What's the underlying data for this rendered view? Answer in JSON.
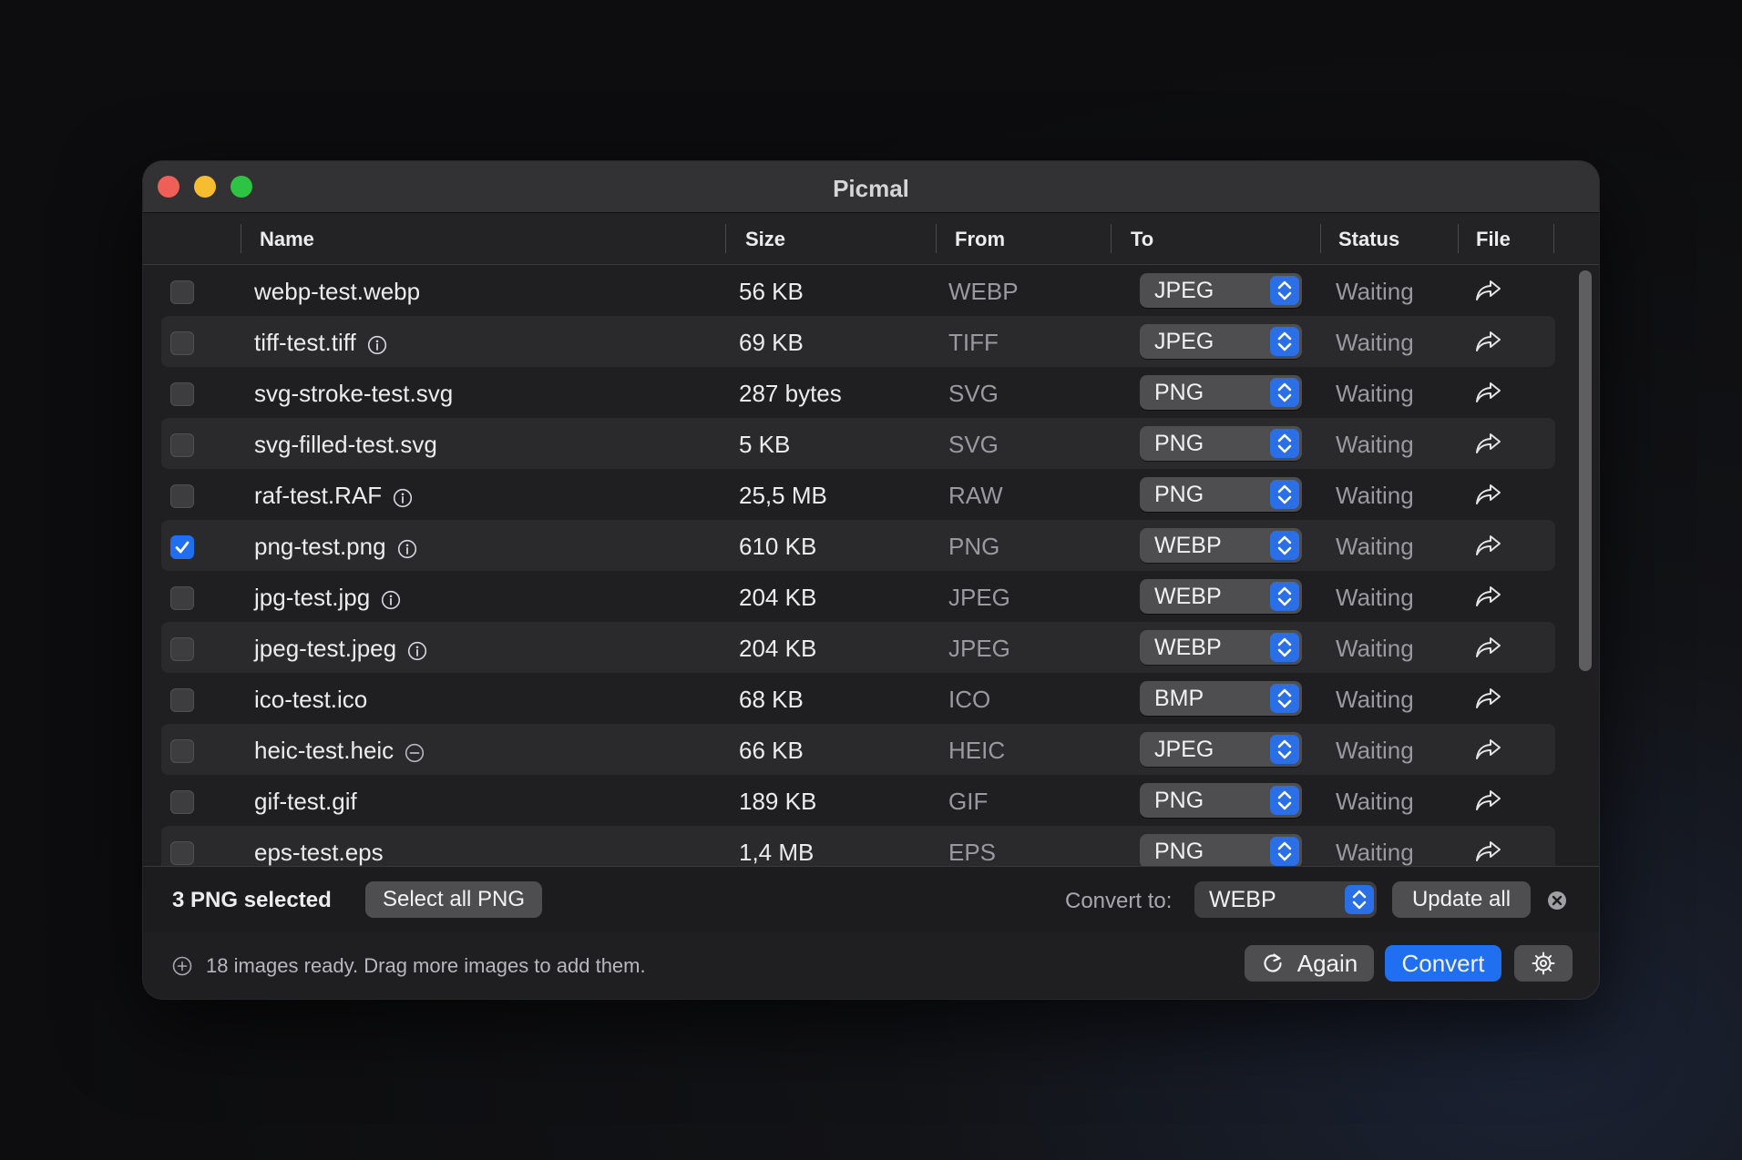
{
  "window": {
    "title": "Picmal"
  },
  "columns": {
    "name": "Name",
    "size": "Size",
    "from": "From",
    "to": "To",
    "status": "Status",
    "file": "File"
  },
  "rows": [
    {
      "name": "webp-test.webp",
      "info": "",
      "size": "56 KB",
      "from": "WEBP",
      "to": "JPEG",
      "status": "Waiting",
      "checked": false
    },
    {
      "name": "tiff-test.tiff",
      "info": "info",
      "size": "69 KB",
      "from": "TIFF",
      "to": "JPEG",
      "status": "Waiting",
      "checked": false
    },
    {
      "name": "svg-stroke-test.svg",
      "info": "",
      "size": "287 bytes",
      "from": "SVG",
      "to": "PNG",
      "status": "Waiting",
      "checked": false
    },
    {
      "name": "svg-filled-test.svg",
      "info": "",
      "size": "5 KB",
      "from": "SVG",
      "to": "PNG",
      "status": "Waiting",
      "checked": false
    },
    {
      "name": "raf-test.RAF",
      "info": "info",
      "size": "25,5 MB",
      "from": "RAW",
      "to": "PNG",
      "status": "Waiting",
      "checked": false
    },
    {
      "name": "png-test.png",
      "info": "info",
      "size": "610 KB",
      "from": "PNG",
      "to": "WEBP",
      "status": "Waiting",
      "checked": true
    },
    {
      "name": "jpg-test.jpg",
      "info": "info",
      "size": "204 KB",
      "from": "JPEG",
      "to": "WEBP",
      "status": "Waiting",
      "checked": false
    },
    {
      "name": "jpeg-test.jpeg",
      "info": "info",
      "size": "204 KB",
      "from": "JPEG",
      "to": "WEBP",
      "status": "Waiting",
      "checked": false
    },
    {
      "name": "ico-test.ico",
      "info": "",
      "size": "68 KB",
      "from": "ICO",
      "to": "BMP",
      "status": "Waiting",
      "checked": false
    },
    {
      "name": "heic-test.heic",
      "info": "minus",
      "size": "66 KB",
      "from": "HEIC",
      "to": "JPEG",
      "status": "Waiting",
      "checked": false
    },
    {
      "name": "gif-test.gif",
      "info": "",
      "size": "189 KB",
      "from": "GIF",
      "to": "PNG",
      "status": "Waiting",
      "checked": false
    },
    {
      "name": "eps-test.eps",
      "info": "",
      "size": "1,4 MB",
      "from": "EPS",
      "to": "PNG",
      "status": "Waiting",
      "checked": false
    }
  ],
  "toolbar": {
    "selection": "3 PNG selected",
    "select_all_label": "Select all PNG",
    "convert_to_label": "Convert to:",
    "convert_to_value": "WEBP",
    "update_all_label": "Update all"
  },
  "statusbar": {
    "text": "18 images ready. Drag more images to add them.",
    "again_label": "Again",
    "convert_label": "Convert"
  },
  "icons": {
    "info": "info-circle-icon",
    "minus": "minus-circle-icon",
    "share": "share-arrow-icon",
    "stepper": "up-down-chevron-icon",
    "clear": "clear-circle-icon",
    "add": "plus-circle-icon",
    "refresh": "refresh-icon",
    "gear": "gear-icon"
  },
  "colors": {
    "accent": "#1f6ff0",
    "window_bg": "#1f1f21",
    "row_alt": "#2a2a2c",
    "traffic_close": "#ed5f57",
    "traffic_min": "#f5bd2f",
    "traffic_max": "#2dc443"
  }
}
